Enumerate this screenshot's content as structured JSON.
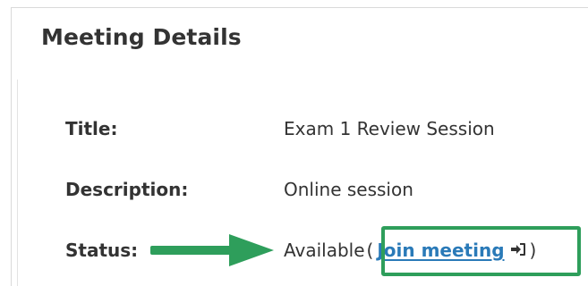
{
  "heading": "Meeting Details",
  "fields": {
    "title_label": "Title:",
    "title_value": "Exam 1 Review Session",
    "description_label": "Description:",
    "description_value": "Online session",
    "status_label": "Status:",
    "status_value": "Available",
    "paren_open": "(",
    "paren_close": ")",
    "join_link": "Join meeting"
  },
  "icons": {
    "join": "sign-in-icon",
    "pointer": "arrow-right-icon"
  },
  "colors": {
    "text": "#333333",
    "link": "#2a7ab8",
    "highlight": "#2e9e5b"
  }
}
